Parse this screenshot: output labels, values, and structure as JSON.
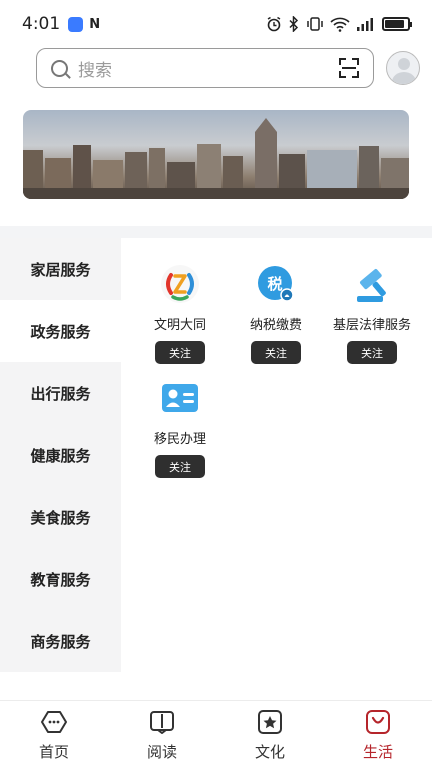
{
  "status_bar": {
    "time": "4:01",
    "nfc": "N",
    "battery_level": 0.85,
    "icons": [
      "app-notification-icon",
      "nfc-icon",
      "alarm-icon",
      "bluetooth-icon",
      "vibrate-icon",
      "wifi-icon",
      "signal-icon",
      "battery-icon"
    ]
  },
  "search": {
    "placeholder": "搜索"
  },
  "sidebar": {
    "items": [
      {
        "label": "家居服务"
      },
      {
        "label": "政务服务"
      },
      {
        "label": "出行服务"
      },
      {
        "label": "健康服务"
      },
      {
        "label": "美食服务"
      },
      {
        "label": "教育服务"
      },
      {
        "label": "商务服务"
      }
    ],
    "active_index": 1
  },
  "services": [
    {
      "label": "文明大同",
      "button": "关注",
      "icon": "civilization-logo-icon"
    },
    {
      "label": "纳税缴费",
      "button": "关注",
      "icon": "tax-icon",
      "icon_text": "税"
    },
    {
      "label": "基层法律服务",
      "button": "关注",
      "icon": "gavel-icon"
    },
    {
      "label": "移民办理",
      "button": "关注",
      "icon": "id-card-icon"
    }
  ],
  "bottom_nav": {
    "items": [
      {
        "label": "首页",
        "icon": "home-icon"
      },
      {
        "label": "阅读",
        "icon": "book-icon"
      },
      {
        "label": "文化",
        "icon": "star-badge-icon"
      },
      {
        "label": "生活",
        "icon": "shopping-bag-icon"
      }
    ],
    "active_index": 3
  },
  "colors": {
    "accent": "#b5252b",
    "service_blue": "#2f9be0",
    "button_dark": "#2f2f2f",
    "sidebar_bg": "#f4f4f5"
  }
}
